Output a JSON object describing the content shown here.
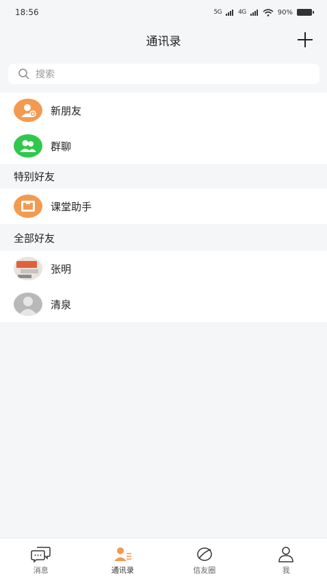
{
  "status_bar": {
    "time": "18:56",
    "signal1": "5G",
    "signal2": "4G",
    "battery": "90%"
  },
  "header": {
    "title": "通讯录"
  },
  "search": {
    "placeholder": "搜索"
  },
  "top_items": [
    {
      "label": "新朋友",
      "icon": "new-friend-icon",
      "color": "#f39a50"
    },
    {
      "label": "群聊",
      "icon": "group-chat-icon",
      "color": "#2fc84a"
    }
  ],
  "special": {
    "title": "特别好友",
    "items": [
      {
        "label": "课堂助手",
        "icon": "classroom-assistant-icon",
        "color": "#f39a50"
      }
    ]
  },
  "all": {
    "title": "全部好友",
    "items": [
      {
        "label": "张明",
        "icon": "avatar-photo"
      },
      {
        "label": "清泉",
        "icon": "avatar-default"
      }
    ]
  },
  "tabs": [
    {
      "label": "消息",
      "icon": "message-icon"
    },
    {
      "label": "通讯录",
      "icon": "contacts-icon",
      "active": true
    },
    {
      "label": "信友圈",
      "icon": "moments-icon"
    },
    {
      "label": "我",
      "icon": "profile-icon"
    }
  ],
  "colors": {
    "accent": "#f39a50",
    "green": "#2fc84a",
    "background": "#f5f6f8"
  }
}
